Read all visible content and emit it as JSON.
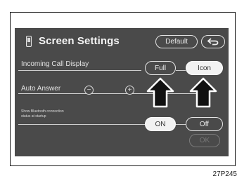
{
  "screen": {
    "title": "Screen Settings",
    "default_label": "Default",
    "back_icon": "back-arrow-icon",
    "rows": {
      "incoming": {
        "label": "Incoming Call Display",
        "opt1": "Full",
        "opt2": "Icon",
        "selected": "Icon"
      },
      "auto_answer": {
        "label": "Auto Answer",
        "minus": "−",
        "plus": "+"
      },
      "bt_status": {
        "label_line1": "Show Bluetooth connection",
        "label_line2": "status at startup",
        "on": "ON",
        "off": "Off",
        "selected": "ON"
      }
    },
    "ok_label": "OK"
  },
  "caption": "27P245",
  "colors": {
    "screen_bg": "#4a4a4a",
    "text": "#ececec",
    "selected_bg": "#f2f2f2"
  }
}
